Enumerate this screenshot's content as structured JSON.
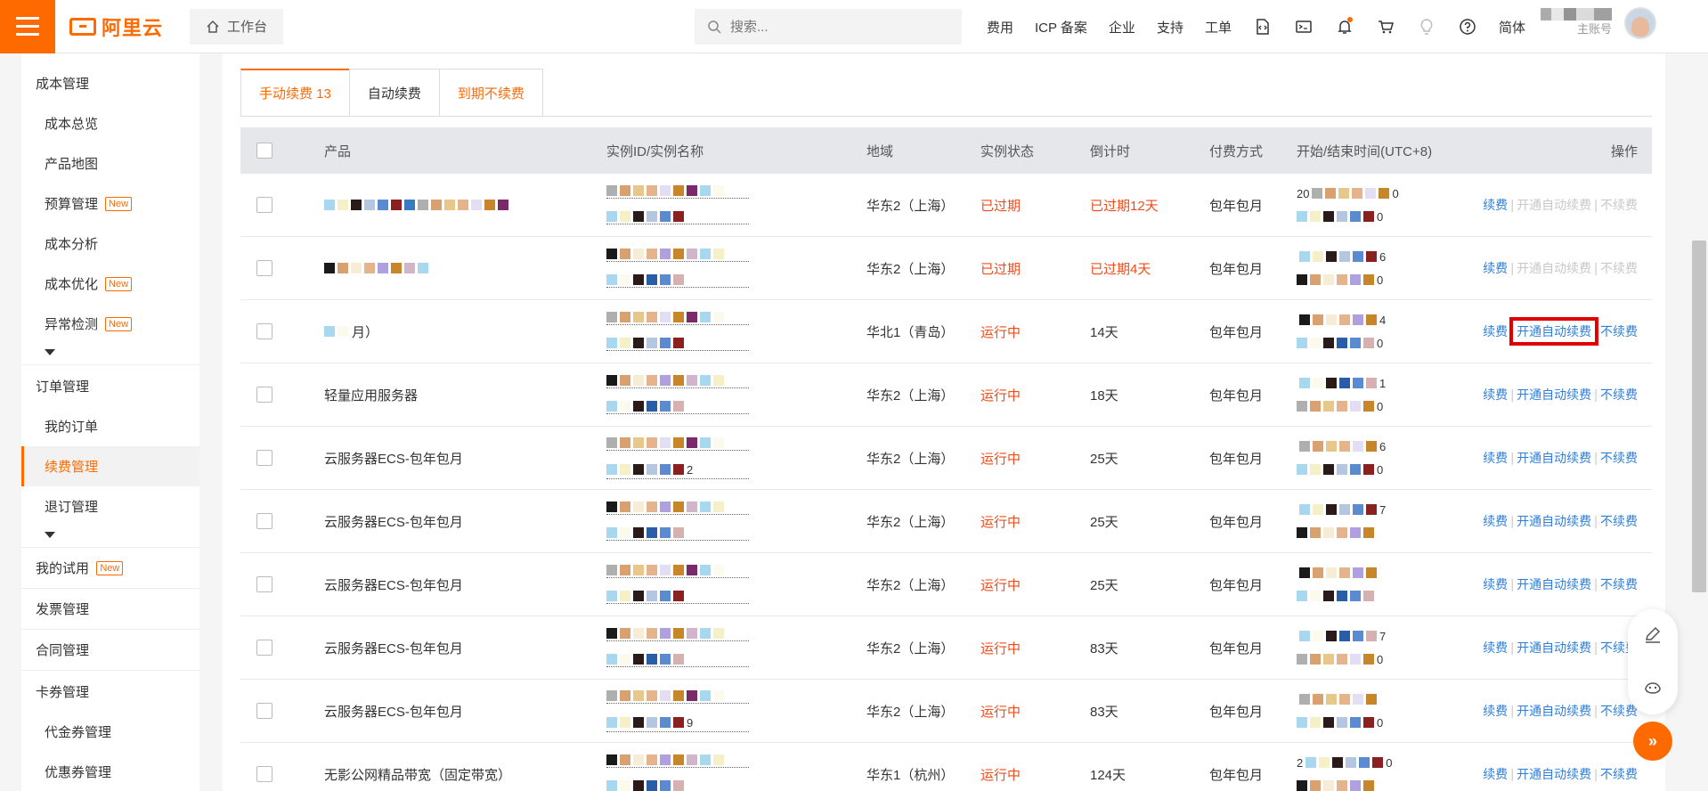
{
  "header": {
    "logo_text": "阿里云",
    "workbench_label": "工作台",
    "search_placeholder": "搜索...",
    "nav": [
      "费用",
      "ICP 备案",
      "企业",
      "支持",
      "工单"
    ],
    "lang_label": "简体",
    "account_label": "主账号"
  },
  "sidebar": {
    "groups": [
      {
        "label": "成本管理",
        "items": [
          {
            "label": "成本总览",
            "badge": ""
          },
          {
            "label": "产品地图",
            "badge": ""
          },
          {
            "label": "预算管理",
            "badge": "New"
          },
          {
            "label": "成本分析",
            "badge": ""
          },
          {
            "label": "成本优化",
            "badge": "New"
          },
          {
            "label": "异常检测",
            "badge": "New"
          }
        ]
      },
      {
        "label": "订单管理",
        "items": [
          {
            "label": "我的订单",
            "badge": ""
          },
          {
            "label": "续费管理",
            "badge": ""
          },
          {
            "label": "退订管理",
            "badge": ""
          }
        ]
      }
    ],
    "trial": {
      "label": "我的试用",
      "badge": "New"
    },
    "invoice": "发票管理",
    "contract": "合同管理",
    "voucher": {
      "label": "卡券管理",
      "items": [
        "代金券管理",
        "优惠券管理"
      ]
    }
  },
  "tabs": [
    {
      "label": "手动续费 13"
    },
    {
      "label": "自动续费"
    },
    {
      "label": "到期不续费"
    }
  ],
  "table": {
    "headers": {
      "product": "产品",
      "instance": "实例ID/实例名称",
      "region": "地域",
      "status": "实例状态",
      "countdown": "倒计时",
      "payment": "付费方式",
      "time": "开始/结束时间(UTC+8)",
      "ops": "操作"
    },
    "ops_labels": {
      "renew": "续费",
      "auto": "开通自动续费",
      "no_renew": "不续费"
    },
    "rows": [
      {
        "product": "",
        "region": "华东2（上海）",
        "status": "已过期",
        "countdown": "已过期12天",
        "payment": "包年包月",
        "id_suffix": "",
        "time_prefix": "20",
        "time_l1_end": "0",
        "time_l2_end": "0",
        "expired": true
      },
      {
        "product": "",
        "region": "华东2（上海）",
        "status": "已过期",
        "countdown": "已过期4天",
        "payment": "包年包月",
        "id_suffix": "",
        "time_prefix": "",
        "time_l1_end": "6",
        "time_l2_end": "0",
        "expired": true
      },
      {
        "product": "月）",
        "region": "华北1（青岛）",
        "status": "运行中",
        "countdown": "14天",
        "payment": "包年包月",
        "id_suffix": "",
        "time_prefix": "",
        "time_l1_end": "4",
        "time_l2_end": "0",
        "expired": false
      },
      {
        "product": "轻量应用服务器",
        "region": "华东2（上海）",
        "status": "运行中",
        "countdown": "18天",
        "payment": "包年包月",
        "id_suffix": "",
        "time_prefix": "",
        "time_l1_end": "1",
        "time_l2_end": "0",
        "expired": false
      },
      {
        "product": "云服务器ECS-包年包月",
        "region": "华东2（上海）",
        "status": "运行中",
        "countdown": "25天",
        "payment": "包年包月",
        "id_suffix": "2",
        "time_prefix": "",
        "time_l1_end": "6",
        "time_l2_end": "0",
        "expired": false
      },
      {
        "product": "云服务器ECS-包年包月",
        "region": "华东2（上海）",
        "status": "运行中",
        "countdown": "25天",
        "payment": "包年包月",
        "id_suffix": "",
        "time_prefix": "",
        "time_l1_end": "7",
        "time_l2_end": "",
        "expired": false
      },
      {
        "product": "云服务器ECS-包年包月",
        "region": "华东2（上海）",
        "status": "运行中",
        "countdown": "25天",
        "payment": "包年包月",
        "id_suffix": "",
        "time_prefix": "",
        "time_l1_end": "",
        "time_l2_end": "",
        "expired": false
      },
      {
        "product": "云服务器ECS-包年包月",
        "region": "华东2（上海）",
        "status": "运行中",
        "countdown": "83天",
        "payment": "包年包月",
        "id_suffix": "",
        "time_prefix": "",
        "time_l1_end": "7",
        "time_l2_end": "0",
        "expired": false
      },
      {
        "product": "云服务器ECS-包年包月",
        "region": "华东2（上海）",
        "status": "运行中",
        "countdown": "83天",
        "payment": "包年包月",
        "id_suffix": "9",
        "time_prefix": "",
        "time_l1_end": "",
        "time_l2_end": "0",
        "expired": false
      },
      {
        "product": "无影公网精品带宽（固定带宽）",
        "region": "华东1（杭州）",
        "status": "运行中",
        "countdown": "124天",
        "payment": "包年包月",
        "id_suffix": "",
        "time_prefix": "2",
        "time_l1_end": "0",
        "time_l2_end": "",
        "expired": false
      }
    ]
  },
  "colors": {
    "brand": "#ff6a00",
    "link": "#2f7fd8",
    "danger": "#f04c1b",
    "disabled": "#c8c8c8",
    "highlight_box": "#e00000"
  }
}
